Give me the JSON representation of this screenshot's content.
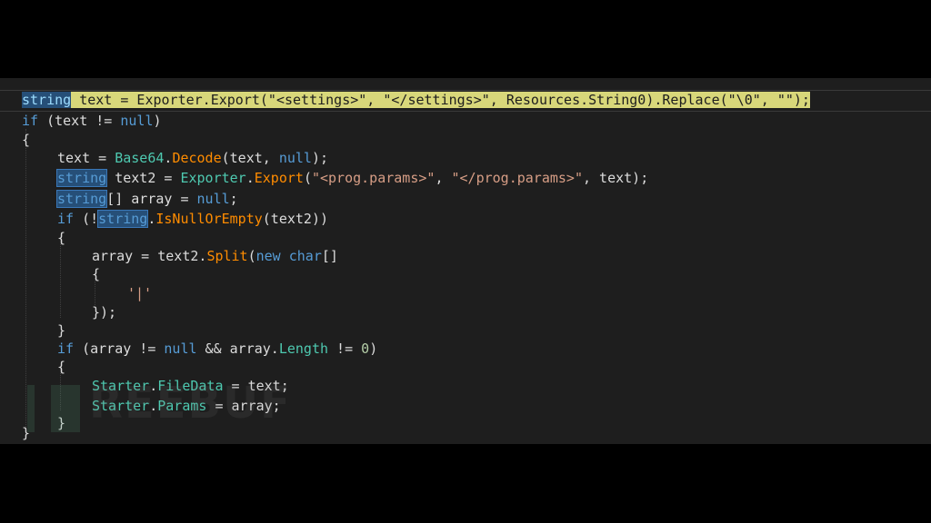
{
  "code_lines": [
    {
      "t1": "string",
      "t2": " text = Exporter.Export(\"<settings>\", \"</settings>\", Resources.String0).Replace(\"\\0\", \"\");"
    },
    {
      "a": "if",
      "b": " (text != ",
      "c": "null",
      "d": ")"
    },
    {
      "a": "{"
    },
    {
      "a": "text = ",
      "b": "Base64",
      "c": ".",
      "d": "Decode",
      "e": "(text, ",
      "f": "null",
      "g": ");"
    },
    {
      "a": "string",
      "b": " text2 = ",
      "c": "Exporter",
      "d": ".",
      "e": "Export",
      "f": "(",
      "g": "\"<prog.params>\"",
      "h": ", ",
      "i": "\"</prog.params>\"",
      "j": ", text);"
    },
    {
      "a": "string",
      "b": "[] array = ",
      "c": "null",
      "d": ";"
    },
    {
      "a": "if",
      "b": " (!",
      "c": "string",
      "d": ".",
      "e": "IsNullOrEmpty",
      "f": "(text2))"
    },
    {
      "a": "{"
    },
    {
      "a": "array = text2.",
      "b": "Split",
      "c": "(",
      "d": "new",
      "e": " ",
      "f": "char",
      "g": "[]"
    },
    {
      "a": "{"
    },
    {
      "a": "'|'"
    },
    {
      "a": "});"
    },
    {
      "a": "}"
    },
    {
      "a": "if",
      "b": " (array != ",
      "c": "null",
      "d": " && array.",
      "e": "Length",
      "f": " != ",
      "g": "0",
      "h": ")"
    },
    {
      "a": "{"
    },
    {
      "a": "Starter",
      "b": ".",
      "c": "FileData",
      "d": " = text;"
    },
    {
      "a": "Starter",
      "b": ".",
      "c": "Params",
      "d": " = array;"
    },
    {
      "a": "}"
    },
    {
      "a": "}"
    }
  ],
  "watermark": "REEBUF",
  "colors": {
    "background": "#1e1e1e",
    "keyword": "#569cd6",
    "type": "#4ec9b0",
    "string": "#d69d85",
    "method": "#ff8c00",
    "find_highlight": "#d8d77a",
    "selection": "#264f78"
  }
}
